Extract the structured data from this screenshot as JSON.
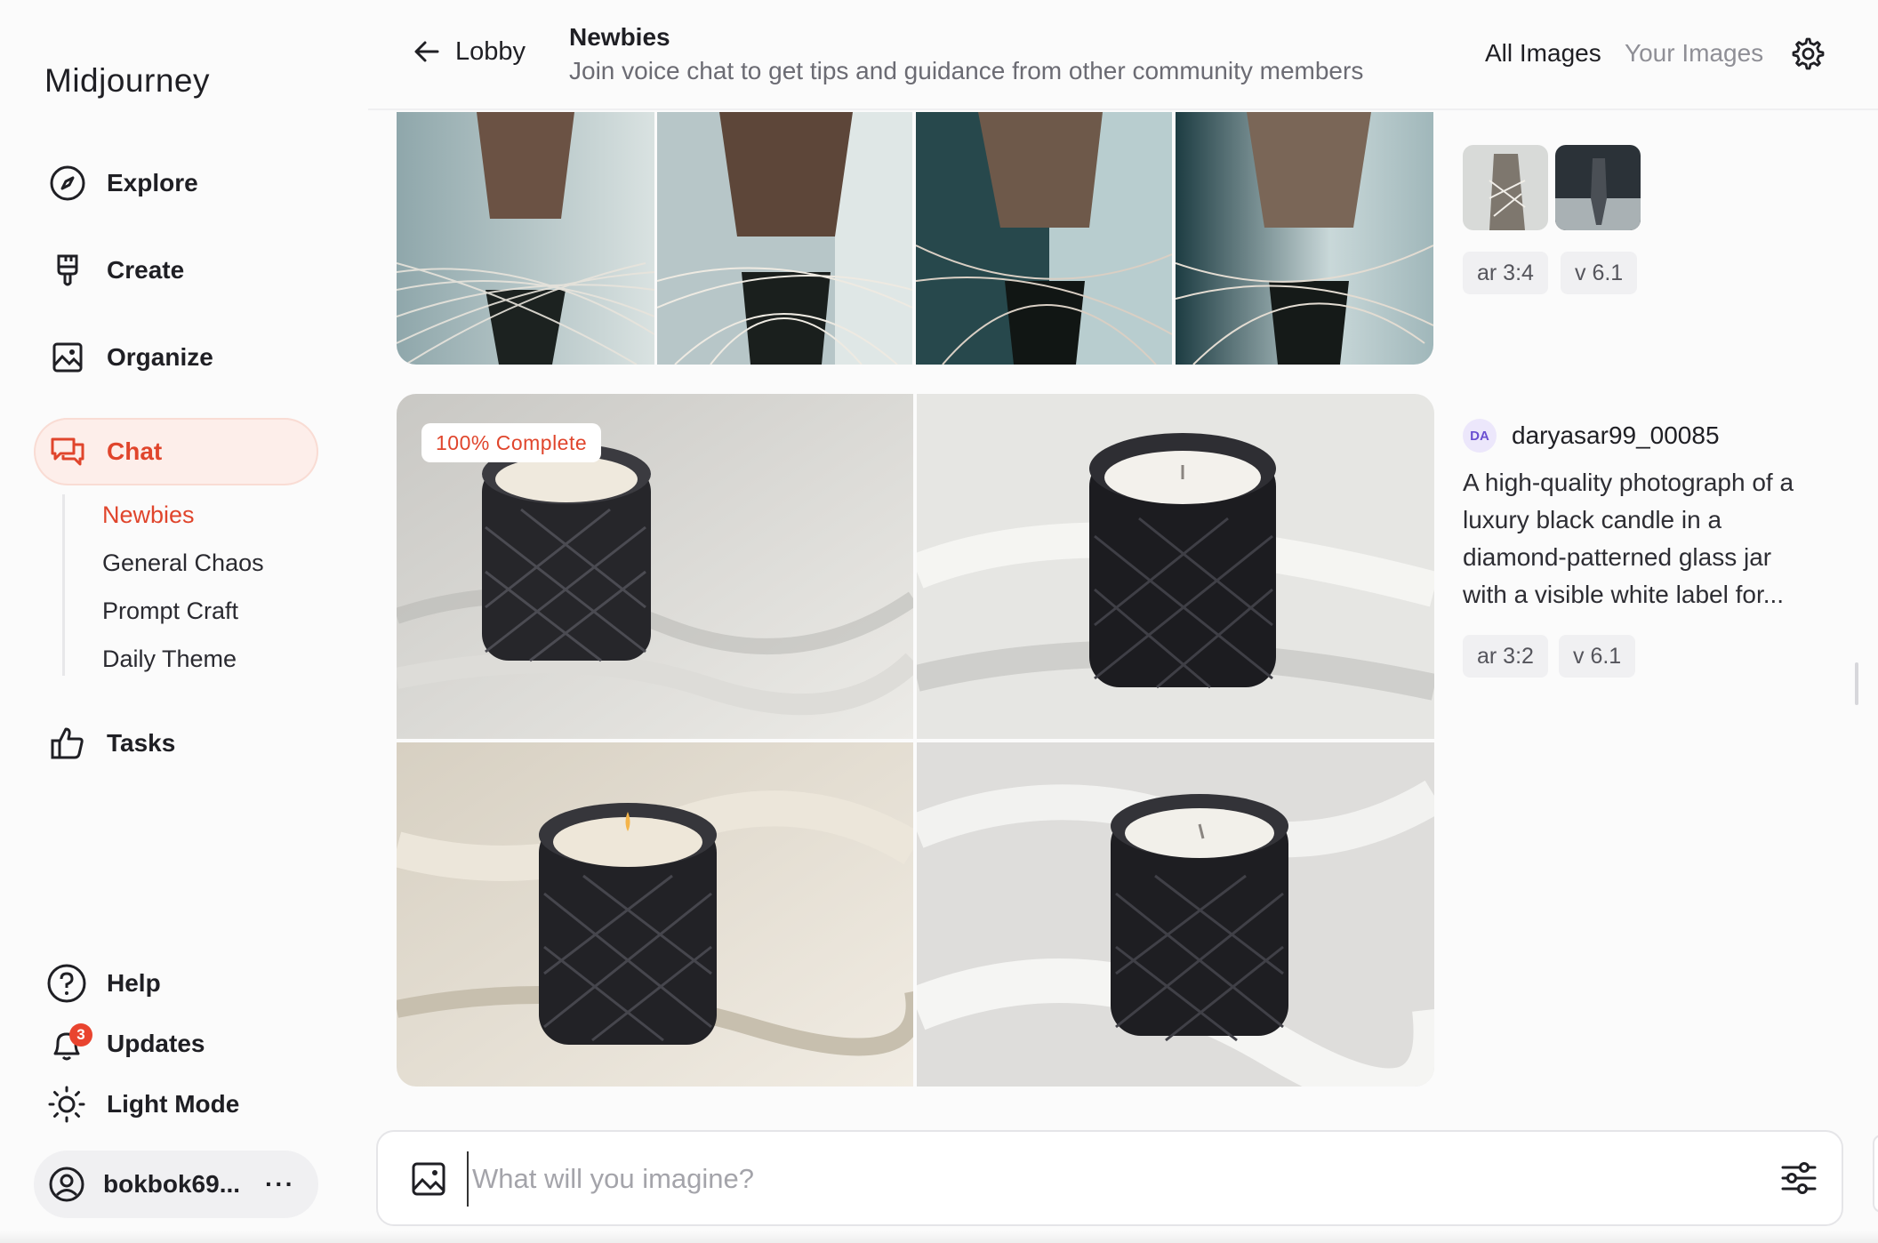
{
  "app": {
    "brand": "Midjourney",
    "accent": "#e0452c"
  },
  "sidebar": {
    "nav": [
      {
        "label": "Explore",
        "icon": "compass-icon"
      },
      {
        "label": "Create",
        "icon": "brush-icon"
      },
      {
        "label": "Organize",
        "icon": "image-icon"
      },
      {
        "label": "Chat",
        "icon": "chat-icon",
        "active": true
      },
      {
        "label": "Tasks",
        "icon": "thumbs-up-icon"
      }
    ],
    "chat_rooms": [
      {
        "label": "Newbies",
        "active": true
      },
      {
        "label": "General Chaos"
      },
      {
        "label": "Prompt Craft"
      },
      {
        "label": "Daily Theme"
      }
    ],
    "bottom": [
      {
        "label": "Help",
        "icon": "question-icon"
      },
      {
        "label": "Updates",
        "icon": "bell-icon",
        "badge": "3"
      },
      {
        "label": "Light Mode",
        "icon": "sun-icon"
      }
    ],
    "user": {
      "name": "bokbok69...",
      "more": "···"
    }
  },
  "header": {
    "back_label": "Lobby",
    "channel_title": "Newbies",
    "channel_description": "Join voice chat to get tips and guidance from other community members",
    "tabs": [
      {
        "label": "All Images",
        "active": true
      },
      {
        "label": "Your Images"
      }
    ]
  },
  "feed": {
    "post1": {
      "images": [
        "dress-image-1",
        "dress-image-2",
        "dress-image-3",
        "dress-image-4"
      ],
      "reference_thumbs": [
        "dress-thumb-1",
        "runway-thumb-2"
      ],
      "tags": [
        "ar 3:4",
        "v 6.1"
      ]
    },
    "post2": {
      "progress_label": "100% Complete",
      "images": [
        "candle-image-1",
        "candle-image-2",
        "candle-image-3",
        "candle-image-4"
      ],
      "avatar_initials": "DA",
      "username": "daryasar99_00085",
      "prompt": "A high-quality photograph of a luxury black candle in a diamond-patterned glass jar with a visible white label for...",
      "tags": [
        "ar 3:2",
        "v 6.1"
      ]
    }
  },
  "composer": {
    "placeholder": "What will you imagine?",
    "value": ""
  }
}
